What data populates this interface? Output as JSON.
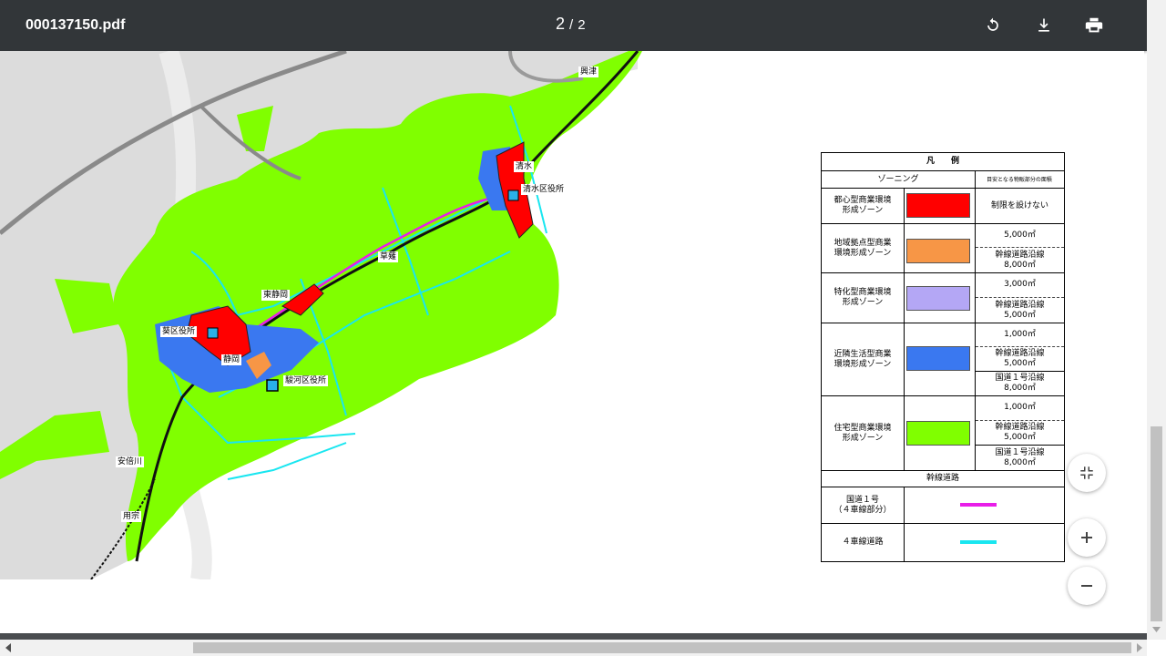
{
  "toolbar": {
    "file_name": "000137150.pdf",
    "current_page": "2",
    "page_separator": "/",
    "total_pages": "2"
  },
  "map_labels": {
    "okitsu": "興津",
    "shimizu": "清水",
    "shimizu_ward": "清水区役所",
    "kusanagi": "草薙",
    "higashi_shizuoka": "東静岡",
    "aoi_ward": "葵区役所",
    "shizuoka": "静岡",
    "suruga_ward": "駿河区役所",
    "abekawa": "安倍川",
    "mochimune": "用宗"
  },
  "legend": {
    "title": "凡　　例",
    "zoning_header": "ゾーニング",
    "area_header": "目安となる物販部分の面積",
    "rows": [
      {
        "name": "都心型商業環境\n形成ゾーン",
        "color": "#ff0000",
        "values": [
          "制限を設けない"
        ]
      },
      {
        "name": "地域拠点型商業\n環境形成ゾーン",
        "color": "#f79646",
        "values": [
          "5,000㎡",
          "幹線道路沿線\n8,000㎡"
        ]
      },
      {
        "name": "特化型商業環境\n形成ゾーン",
        "color": "#b4a7f5",
        "values": [
          "3,000㎡",
          "幹線道路沿線\n5,000㎡"
        ]
      },
      {
        "name": "近隣生活型商業\n環境形成ゾーン",
        "color": "#3a78f0",
        "values": [
          "1,000㎡",
          "幹線道路沿線\n5,000㎡",
          "国道１号沿線\n8,000㎡"
        ]
      },
      {
        "name": "住宅型商業環境\n形成ゾーン",
        "color": "#80ff00",
        "values": [
          "1,000㎡",
          "幹線道路沿線\n5,000㎡",
          "国道１号沿線\n8,000㎡"
        ]
      }
    ],
    "roads_header": "幹線道路",
    "roads": [
      {
        "name": "国道１号\n（４車線部分）",
        "color": "#e81ee8"
      },
      {
        "name": "４車線道路",
        "color": "#19e6f0"
      }
    ]
  }
}
